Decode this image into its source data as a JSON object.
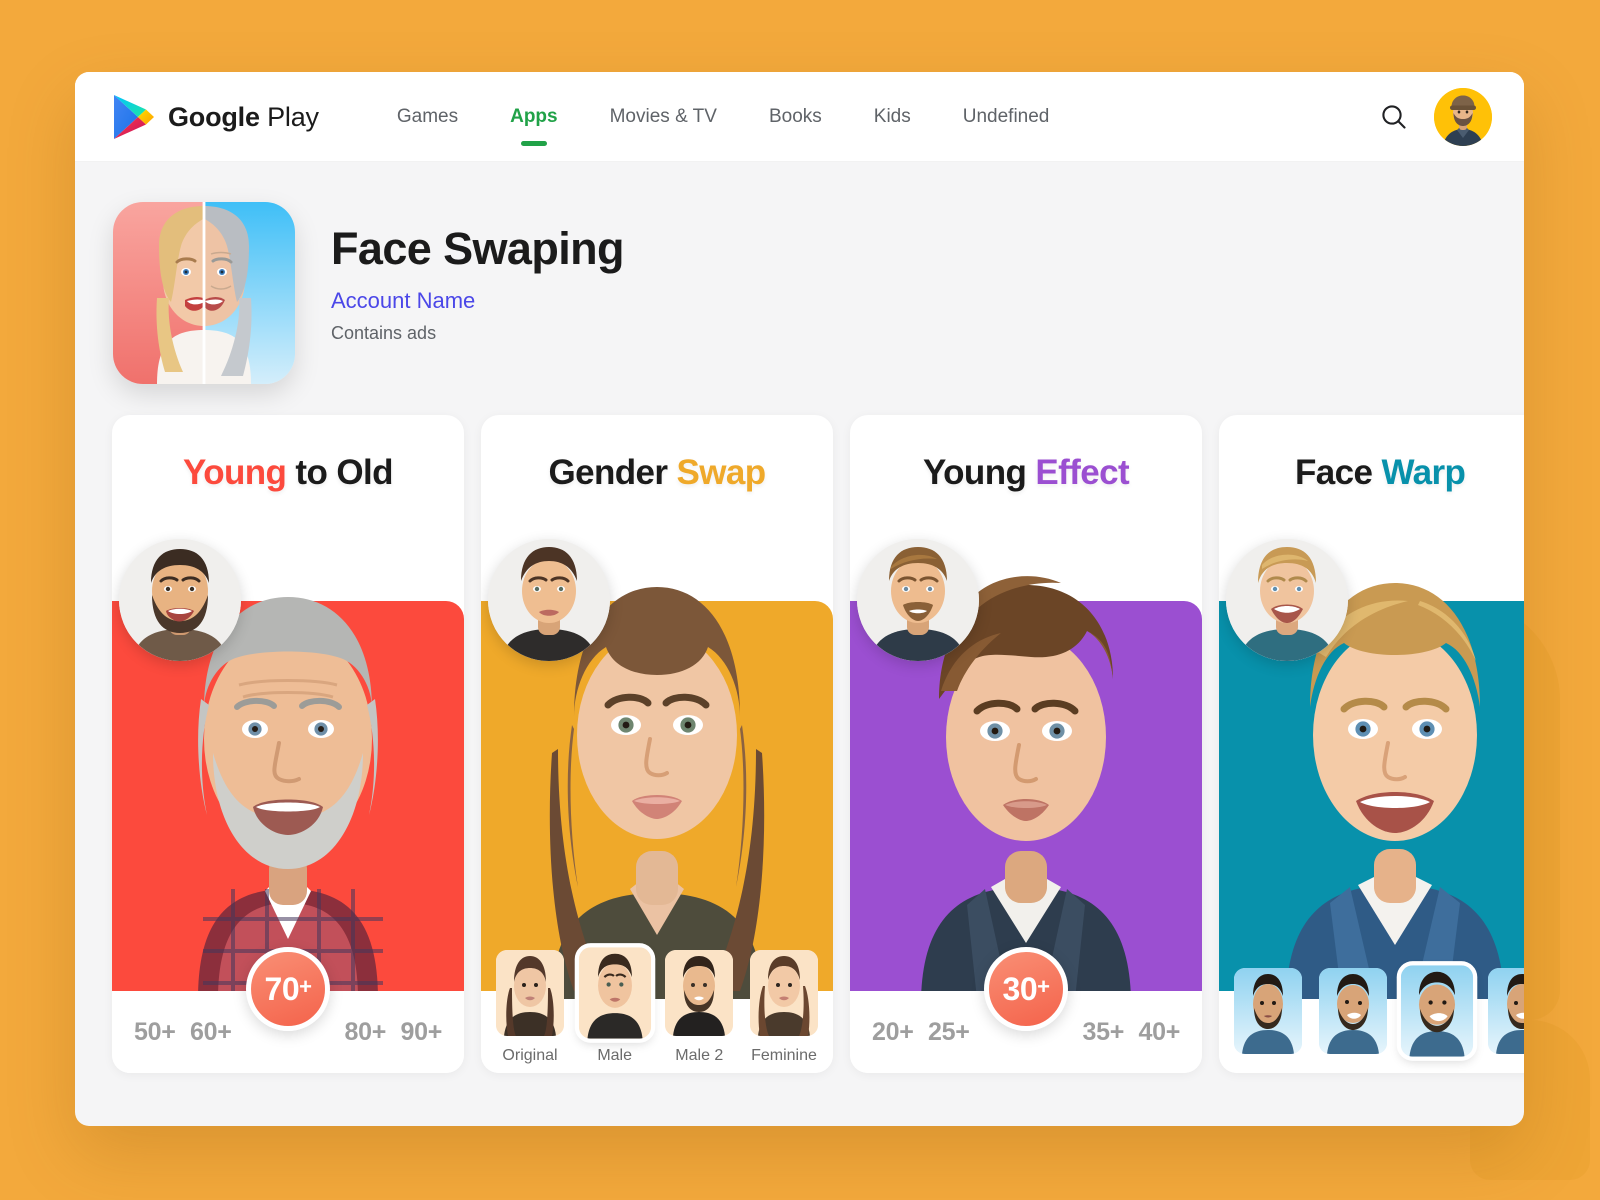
{
  "page": {
    "background_color": "#F3A93C"
  },
  "topnav": {
    "brand_bold": "Google",
    "brand_thin": "Play",
    "tabs": [
      {
        "label": "Games",
        "active": false
      },
      {
        "label": "Apps",
        "active": true
      },
      {
        "label": "Movies & TV",
        "active": false
      },
      {
        "label": "Books",
        "active": false
      },
      {
        "label": "Kids",
        "active": false
      },
      {
        "label": "Undefined",
        "active": false
      }
    ],
    "active_tab_color": "#21A248",
    "search_icon": "search-icon",
    "avatar_icon": "user-avatar",
    "avatar_background": "#FFC107"
  },
  "app_header": {
    "icon_name": "face-swap-app-icon",
    "title": "Face Swaping",
    "account": "Account Name",
    "account_color": "#4B47E8",
    "ads_note": "Contains ads"
  },
  "cards": [
    {
      "title_part1": "Young",
      "title_part2": " to Old",
      "accent_color": "#FC4A3D",
      "accent_on_first": true,
      "panel_color": "#FC4A3D",
      "control_type": "age",
      "age_options": [
        "50+",
        "60+",
        "80+",
        "90+"
      ],
      "age_selected": "70",
      "age_selected_suffix": "+",
      "face_badge": "young-man-source-face",
      "portrait": "older-man-result-portrait"
    },
    {
      "title_part1": "Gender",
      "title_part2": " Swap",
      "accent_color": "#EFA92A",
      "accent_on_first": false,
      "panel_color": "#EFA92A",
      "control_type": "thumbs",
      "thumbs": [
        {
          "label": "Original",
          "selected": false,
          "name": "thumb-original"
        },
        {
          "label": "Male",
          "selected": true,
          "name": "thumb-male"
        },
        {
          "label": "Male 2",
          "selected": false,
          "name": "thumb-male-2"
        },
        {
          "label": "Feminine",
          "selected": false,
          "name": "thumb-feminine"
        }
      ],
      "face_badge": "young-man-source-face",
      "portrait": "young-woman-result-portrait"
    },
    {
      "title_part1": "Young",
      "title_part2": " Effect",
      "accent_color": "#9B4FD1",
      "accent_on_first": false,
      "panel_color": "#9B4FD1",
      "control_type": "age",
      "age_options": [
        "20+",
        "25+",
        "35+",
        "40+"
      ],
      "age_selected": "30",
      "age_selected_suffix": "+",
      "face_badge": "mature-man-source-face",
      "portrait": "young-man-result-portrait"
    },
    {
      "title_part1": "Face",
      "title_part2": " Warp",
      "accent_color": "#0891AB",
      "accent_on_first": false,
      "panel_color": "#0891AB",
      "control_type": "thumbs",
      "thumbs": [
        {
          "label": "",
          "selected": false,
          "name": "thumb-warp-1"
        },
        {
          "label": "",
          "selected": false,
          "name": "thumb-warp-2"
        },
        {
          "label": "",
          "selected": true,
          "name": "thumb-warp-3"
        },
        {
          "label": "",
          "selected": false,
          "name": "thumb-warp-4"
        }
      ],
      "face_badge": "blond-man-source-face",
      "portrait": "blond-man-result-portrait"
    }
  ]
}
